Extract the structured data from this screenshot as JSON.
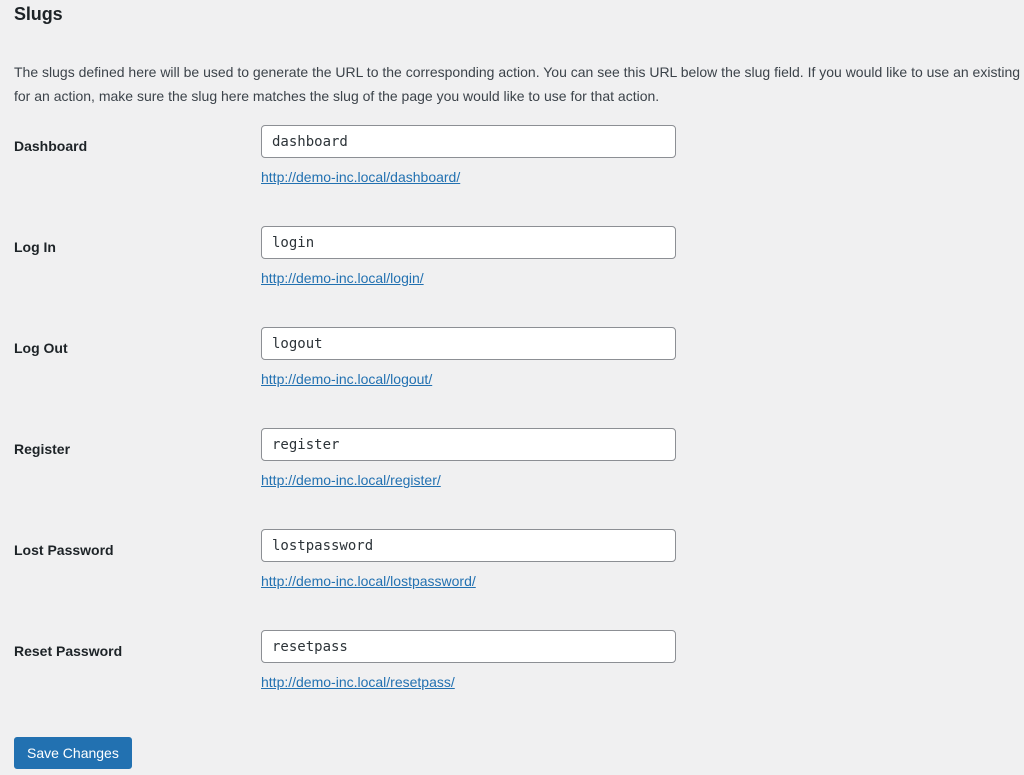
{
  "section": {
    "title": "Slugs",
    "description": "The slugs defined here will be used to generate the URL to the corresponding action. You can see this URL below the slug field. If you would like to use an existing page for an action, make sure the slug here matches the slug of the page you would like to use for that action."
  },
  "colors": {
    "page_background": "#f0f0f1",
    "link": "#2271b1",
    "button_background": "#2271b1",
    "label_text": "#1d2327",
    "body_text": "#3c434a",
    "input_border": "#8c8f94",
    "input_background": "#ffffff"
  },
  "fields": [
    {
      "label": "Dashboard",
      "value": "dashboard",
      "placeholder": "dashboard",
      "url": "http://demo-inc.local/dashboard/"
    },
    {
      "label": "Log In",
      "value": "login",
      "placeholder": "login",
      "url": "http://demo-inc.local/login/"
    },
    {
      "label": "Log Out",
      "value": "logout",
      "placeholder": "logout",
      "url": "http://demo-inc.local/logout/"
    },
    {
      "label": "Register",
      "value": "register",
      "placeholder": "register",
      "url": "http://demo-inc.local/register/"
    },
    {
      "label": "Lost Password",
      "value": "lostpassword",
      "placeholder": "lostpassword",
      "url": "http://demo-inc.local/lostpassword/"
    },
    {
      "label": "Reset Password",
      "value": "resetpass",
      "placeholder": "resetpass",
      "url": "http://demo-inc.local/resetpass/"
    }
  ],
  "submit": {
    "save_label": "Save Changes"
  }
}
